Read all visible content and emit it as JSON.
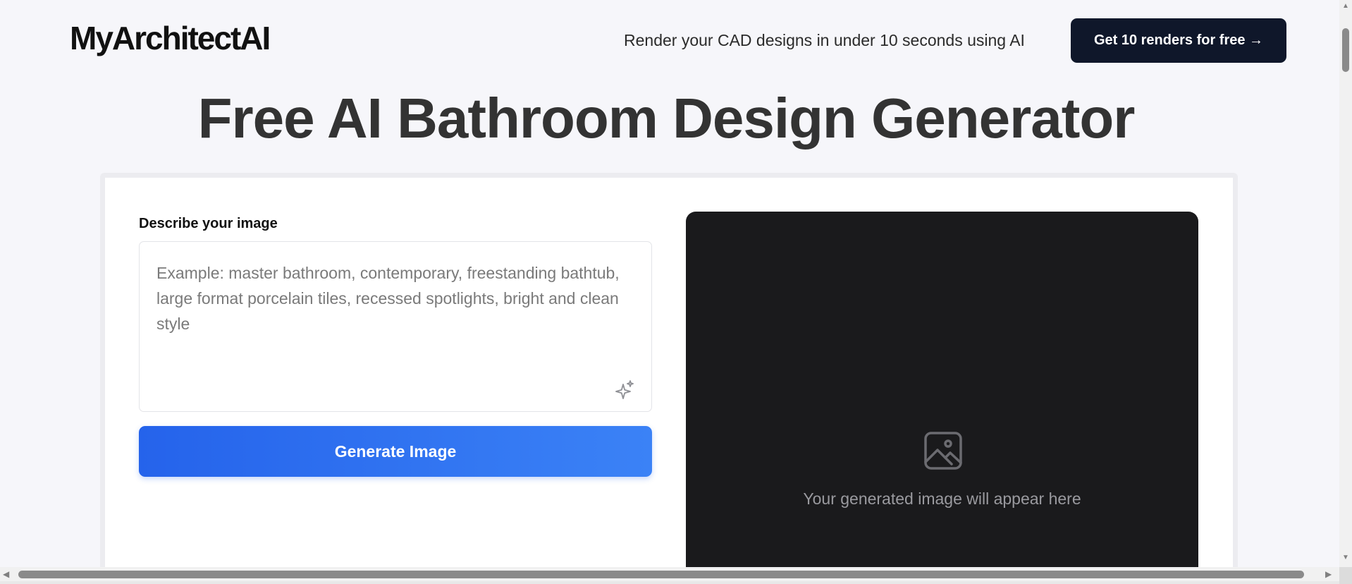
{
  "header": {
    "logo": "MyArchitectAI",
    "tagline": "Render your CAD designs in under 10 seconds using AI",
    "cta_label": "Get 10 renders for free →"
  },
  "main": {
    "title": "Free AI Bathroom Design Generator"
  },
  "form": {
    "label": "Describe your image",
    "placeholder": "Example: master bathroom, contemporary, freestanding bathtub, large format porcelain tiles, recessed spotlights, bright and clean style",
    "enhance_icon": "sparkle-icon",
    "generate_label": "Generate Image"
  },
  "preview": {
    "icon": "image-icon",
    "placeholder_text": "Your generated image will appear here"
  },
  "colors": {
    "page_bg": "#f6f6fa",
    "cta_bg": "#0f172a",
    "button_gradient_start": "#2563eb",
    "button_gradient_end": "#3b82f6",
    "preview_bg": "#1a1a1c"
  }
}
